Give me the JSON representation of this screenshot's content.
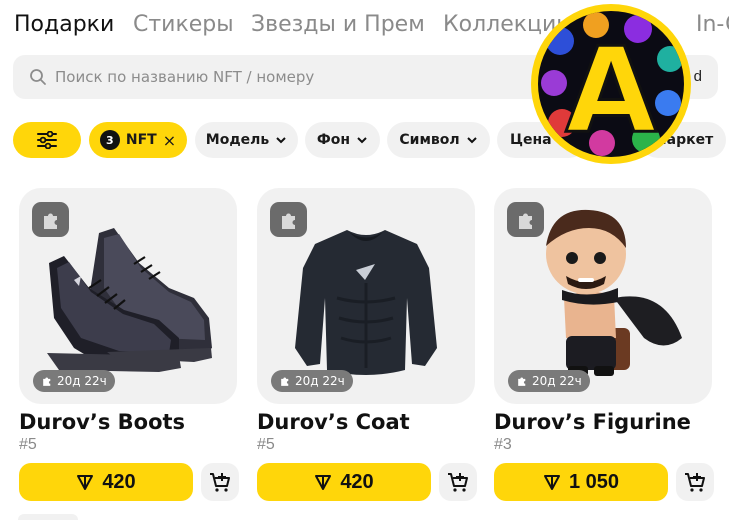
{
  "tabs": [
    "Подарки",
    "Стикеры",
    "Звезды и Прем",
    "Коллекции",
    "In-G"
  ],
  "search": {
    "placeholder": "Поиск по названию NFT / номеру",
    "tail": "d"
  },
  "filters": {
    "active": {
      "count": "3",
      "label": "NFT",
      "clear": "×"
    },
    "items": [
      "Модель",
      "Фон",
      "Символ",
      "Цена",
      "Маркет"
    ]
  },
  "cards": [
    {
      "name": "Durov’s Boots",
      "number": "#5",
      "timer": "20д 22ч",
      "price": "420",
      "icon": "boots-image"
    },
    {
      "name": "Durov’s Coat",
      "number": "#5",
      "timer": "20д 22ч",
      "price": "420",
      "icon": "coat-image"
    },
    {
      "name": "Durov’s Figurine",
      "number": "#3",
      "timer": "20д 22ч",
      "price": "1 050",
      "icon": "figurine-image"
    }
  ],
  "logo": {
    "letter": "A"
  },
  "colors": {
    "accent": "#ffd60a",
    "chip_bg": "#f1f1f1",
    "muted": "#8a8a8a"
  }
}
